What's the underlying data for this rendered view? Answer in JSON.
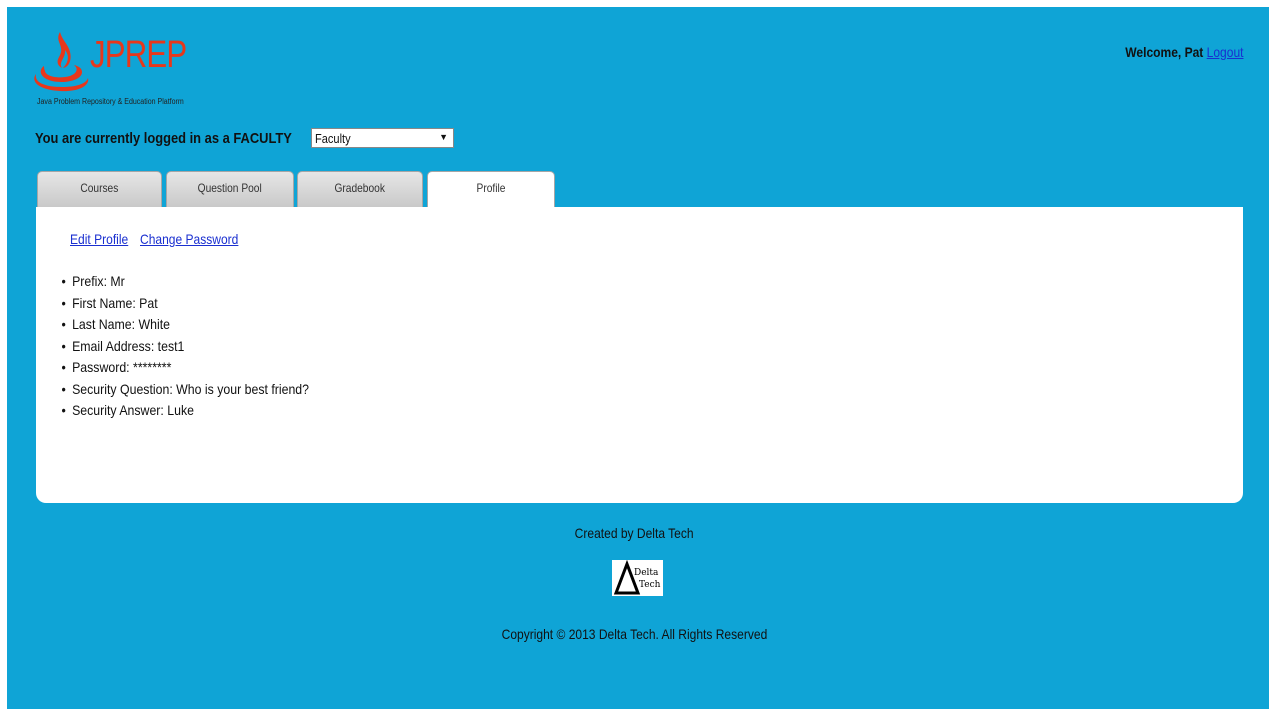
{
  "header": {
    "logo_title": "JPREP",
    "logo_subtitle": "Java Problem Repository & Education Platform",
    "welcome_text": "Welcome, Pat",
    "logout_label": "Logout",
    "role_text": "You are currently logged in as a FACULTY",
    "role_selected": "Faculty"
  },
  "tabs": [
    {
      "label": "Courses"
    },
    {
      "label": "Question Pool"
    },
    {
      "label": "Gradebook"
    },
    {
      "label": "Profile",
      "active": true
    }
  ],
  "profile": {
    "edit_profile_label": "Edit Profile",
    "change_password_label": "Change Password",
    "fields": [
      "Prefix: Mr",
      "First Name: Pat",
      "Last Name: White",
      "Email Address: test1",
      "Password: ********",
      "Security Question: Who is your best friend?",
      "Security Answer: Luke"
    ]
  },
  "footer": {
    "created_by": "Created by Delta Tech",
    "delta_logo_text": [
      "Delta",
      "Tech"
    ],
    "copyright": "Copyright © 2013 Delta Tech. All Rights Reserved"
  },
  "colors": {
    "background": "#0fa4d6",
    "logo": "#e8371b",
    "link": "#1a2fd0"
  }
}
